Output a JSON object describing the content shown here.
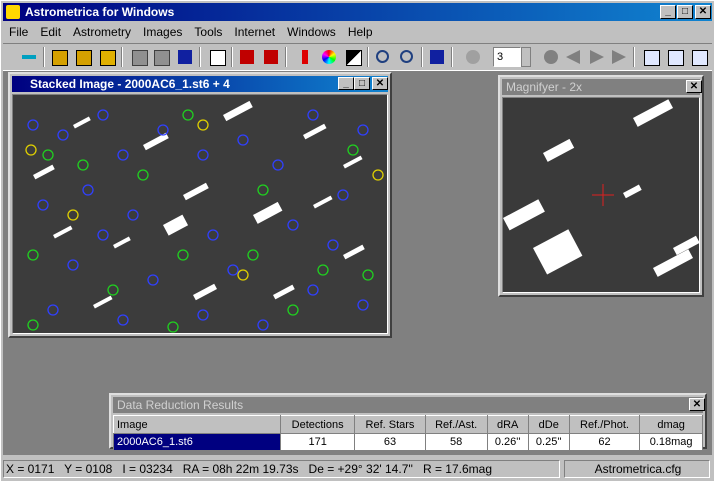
{
  "app": {
    "title": "Astrometrica for Windows"
  },
  "menu": [
    "File",
    "Edit",
    "Astrometry",
    "Images",
    "Tools",
    "Internet",
    "Windows",
    "Help"
  ],
  "toolbar": {
    "frame_count": "3"
  },
  "stacked_window": {
    "title": "Stacked Image - 2000AC6_1.st6 + 4"
  },
  "magnifier_window": {
    "title": "Magnifyer - 2x"
  },
  "results": {
    "title": "Data Reduction Results",
    "columns": [
      "Image",
      "Detections",
      "Ref. Stars",
      "Ref./Ast.",
      "dRA",
      "dDe",
      "Ref./Phot.",
      "dmag"
    ],
    "rows": [
      [
        "2000AC6_1.st6",
        "171",
        "63",
        "58",
        "0.26''",
        "0.25''",
        "62",
        "0.18mag"
      ]
    ]
  },
  "status": {
    "x": "X = 0171",
    "y": "Y = 0108",
    "i": "I = 03234",
    "ra": "RA = 08h 22m 19.73s",
    "de": "De = +29° 32' 14.7''",
    "r": "R = 17.6mag",
    "config": "Astrometrica.cfg"
  }
}
